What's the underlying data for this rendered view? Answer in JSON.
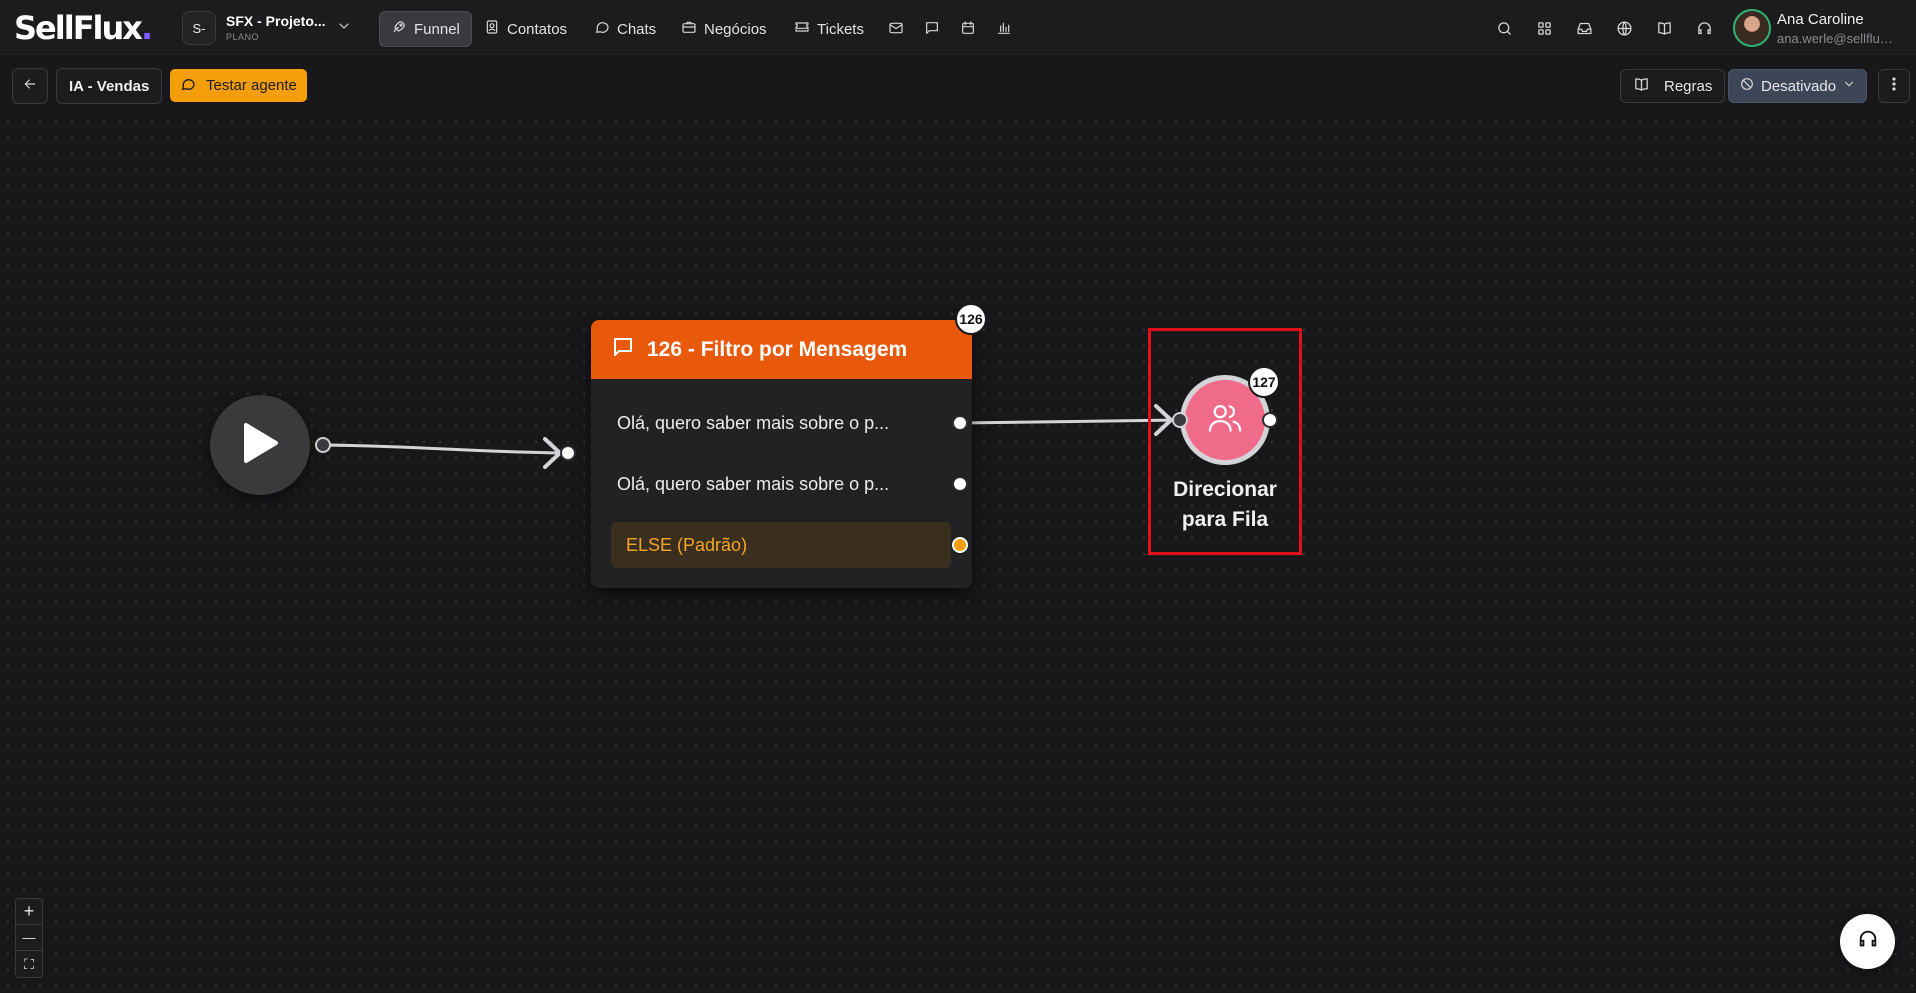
{
  "app": {
    "logo_text": "SellFlux",
    "logo_dot": "."
  },
  "project": {
    "avatar": "S-",
    "name": "SFX - Projeto...",
    "plan": "PLANO"
  },
  "nav": {
    "tabs": [
      {
        "label": "Funnel",
        "icon": "rocket-icon",
        "active": true
      },
      {
        "label": "Contatos",
        "icon": "contacts-icon"
      },
      {
        "label": "Chats",
        "icon": "chat-icon"
      },
      {
        "label": "Negócios",
        "icon": "briefcase-icon"
      },
      {
        "label": "Tickets",
        "icon": "ticket-icon"
      }
    ],
    "icon_only": [
      "mail-icon",
      "message-square-icon",
      "calendar-icon",
      "bar-chart-icon"
    ],
    "right_icons": [
      "search-icon",
      "apps-grid-icon",
      "inbox-icon",
      "globe-icon",
      "book-icon",
      "headset-icon"
    ]
  },
  "user": {
    "name": "Ana Caroline",
    "email": "ana.werle@sellflux..."
  },
  "toolbar": {
    "agent_name": "IA - Vendas",
    "test_button": "Testar agente",
    "rules_button": "Regras",
    "status_button": "Desativado"
  },
  "flow": {
    "filter_node": {
      "badge": "126",
      "title": "126 - Filtro por Mensagem",
      "options": [
        "Olá, quero saber mais sobre o p...",
        "Olá, quero saber mais sobre o p..."
      ],
      "else_option": "ELSE (Padrão)"
    },
    "queue_node": {
      "badge": "127",
      "label_line1": "Direcionar",
      "label_line2": "para Fila"
    }
  },
  "zoom": {
    "in": "+",
    "out": "—",
    "fit": "⛶"
  },
  "colors": {
    "accent_orange": "#e8590c",
    "test_button": "#f59e0b",
    "queue_node": "#f06b8a",
    "highlight_frame": "#e10f1a"
  }
}
